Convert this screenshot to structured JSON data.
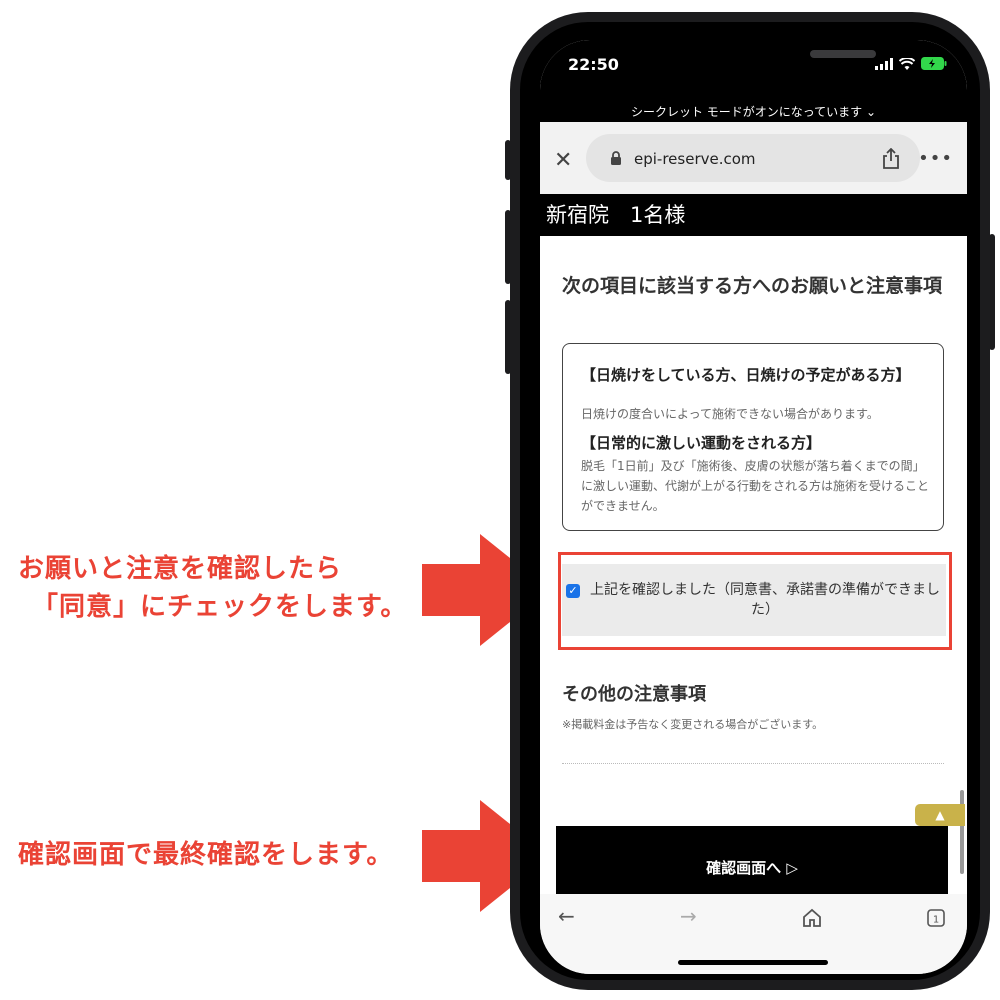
{
  "annotations": {
    "step1_line1": "お願いと注意を確認したら",
    "step1_line2": "「同意」にチェックをします。",
    "step2": "確認画面で最終確認をします。"
  },
  "status_bar": {
    "time": "22:50"
  },
  "browser": {
    "incognito_banner": "シークレット モードがオンになっています",
    "url": "epi-reserve.com"
  },
  "page": {
    "header": "新宿院　1名様",
    "section_title": "次の項目に該当する方へのお願いと注意事項",
    "items": [
      {
        "title": "【日焼けをしている方、日焼けの予定がある方】",
        "desc": "日焼けの度合いによって施術できない場合があります。"
      },
      {
        "title": "【日常的に激しい運動をされる方】",
        "desc": "脱毛「1日前」及び「施術後、皮膚の状態が落ち着くまでの間」に激しい運動、代謝が上がる行動をされる方は施術を受けることができません。"
      }
    ],
    "agree_label": "上記を確認しました（同意書、承諾書の準備ができました）",
    "agree_checked": true,
    "other_title": "その他の注意事項",
    "other_note": "※掲載料金は予告なく変更される場合がございます。",
    "confirm_button": "確認画面へ ▷"
  },
  "icons": [
    "close-icon",
    "lock-icon",
    "share-icon",
    "more-icon",
    "back-icon",
    "forward-icon",
    "home-icon",
    "tabs-icon",
    "scroll-top-icon",
    "signal-icon",
    "wifi-icon",
    "battery-icon"
  ],
  "colors": {
    "annotation_red": "#ea4335",
    "checkbox_blue": "#1a73e8",
    "scroll_gold": "#c9b24a"
  }
}
